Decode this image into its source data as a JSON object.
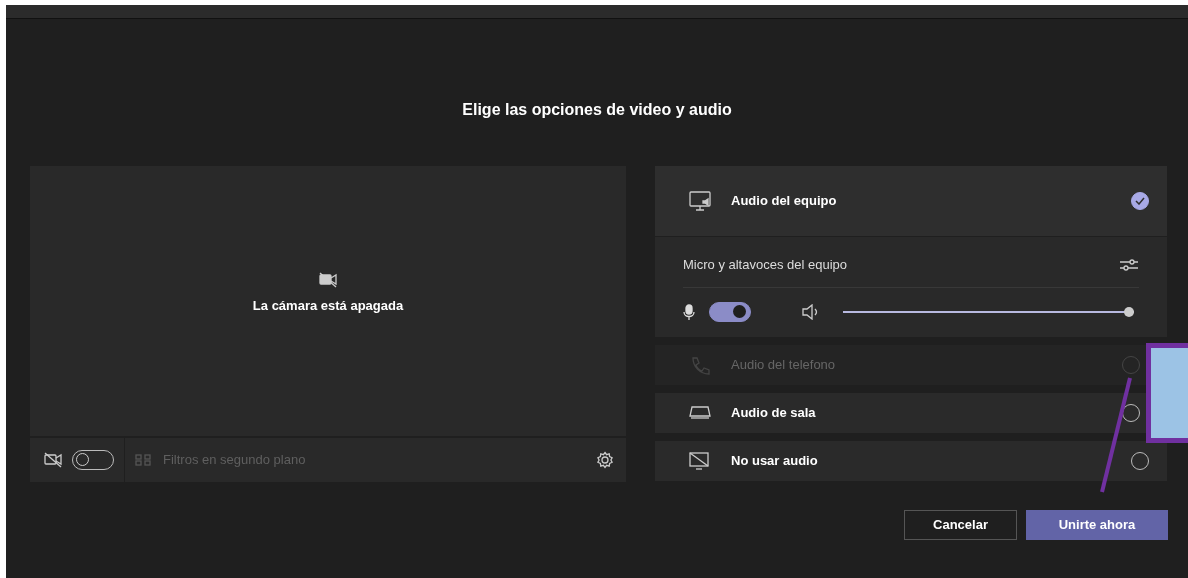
{
  "title": "Elige las opciones de video y audio",
  "preview": {
    "camera_status": "La cámara está apagada",
    "camera_on": false,
    "background_filters": "Filtros en segundo plano",
    "filters_disabled": true
  },
  "audio_options": [
    {
      "kind": "computer",
      "label": "Audio del equipo",
      "selected": true,
      "disabled": false
    },
    {
      "kind": "phone",
      "label": "Audio del telefono",
      "selected": false,
      "disabled": true
    },
    {
      "kind": "room",
      "label": "Audio de sala",
      "selected": false,
      "disabled": false
    },
    {
      "kind": "none",
      "label": "No usar audio",
      "selected": false,
      "disabled": false
    }
  ],
  "device_settings": {
    "label": "Micro y altavoces del equipo",
    "mic_on": true,
    "speaker": {
      "level": 1.0
    }
  },
  "buttons": [
    {
      "label": "Cancelar",
      "kind": "secondary"
    },
    {
      "label": "Unirte ahora",
      "kind": "primary"
    }
  ]
}
